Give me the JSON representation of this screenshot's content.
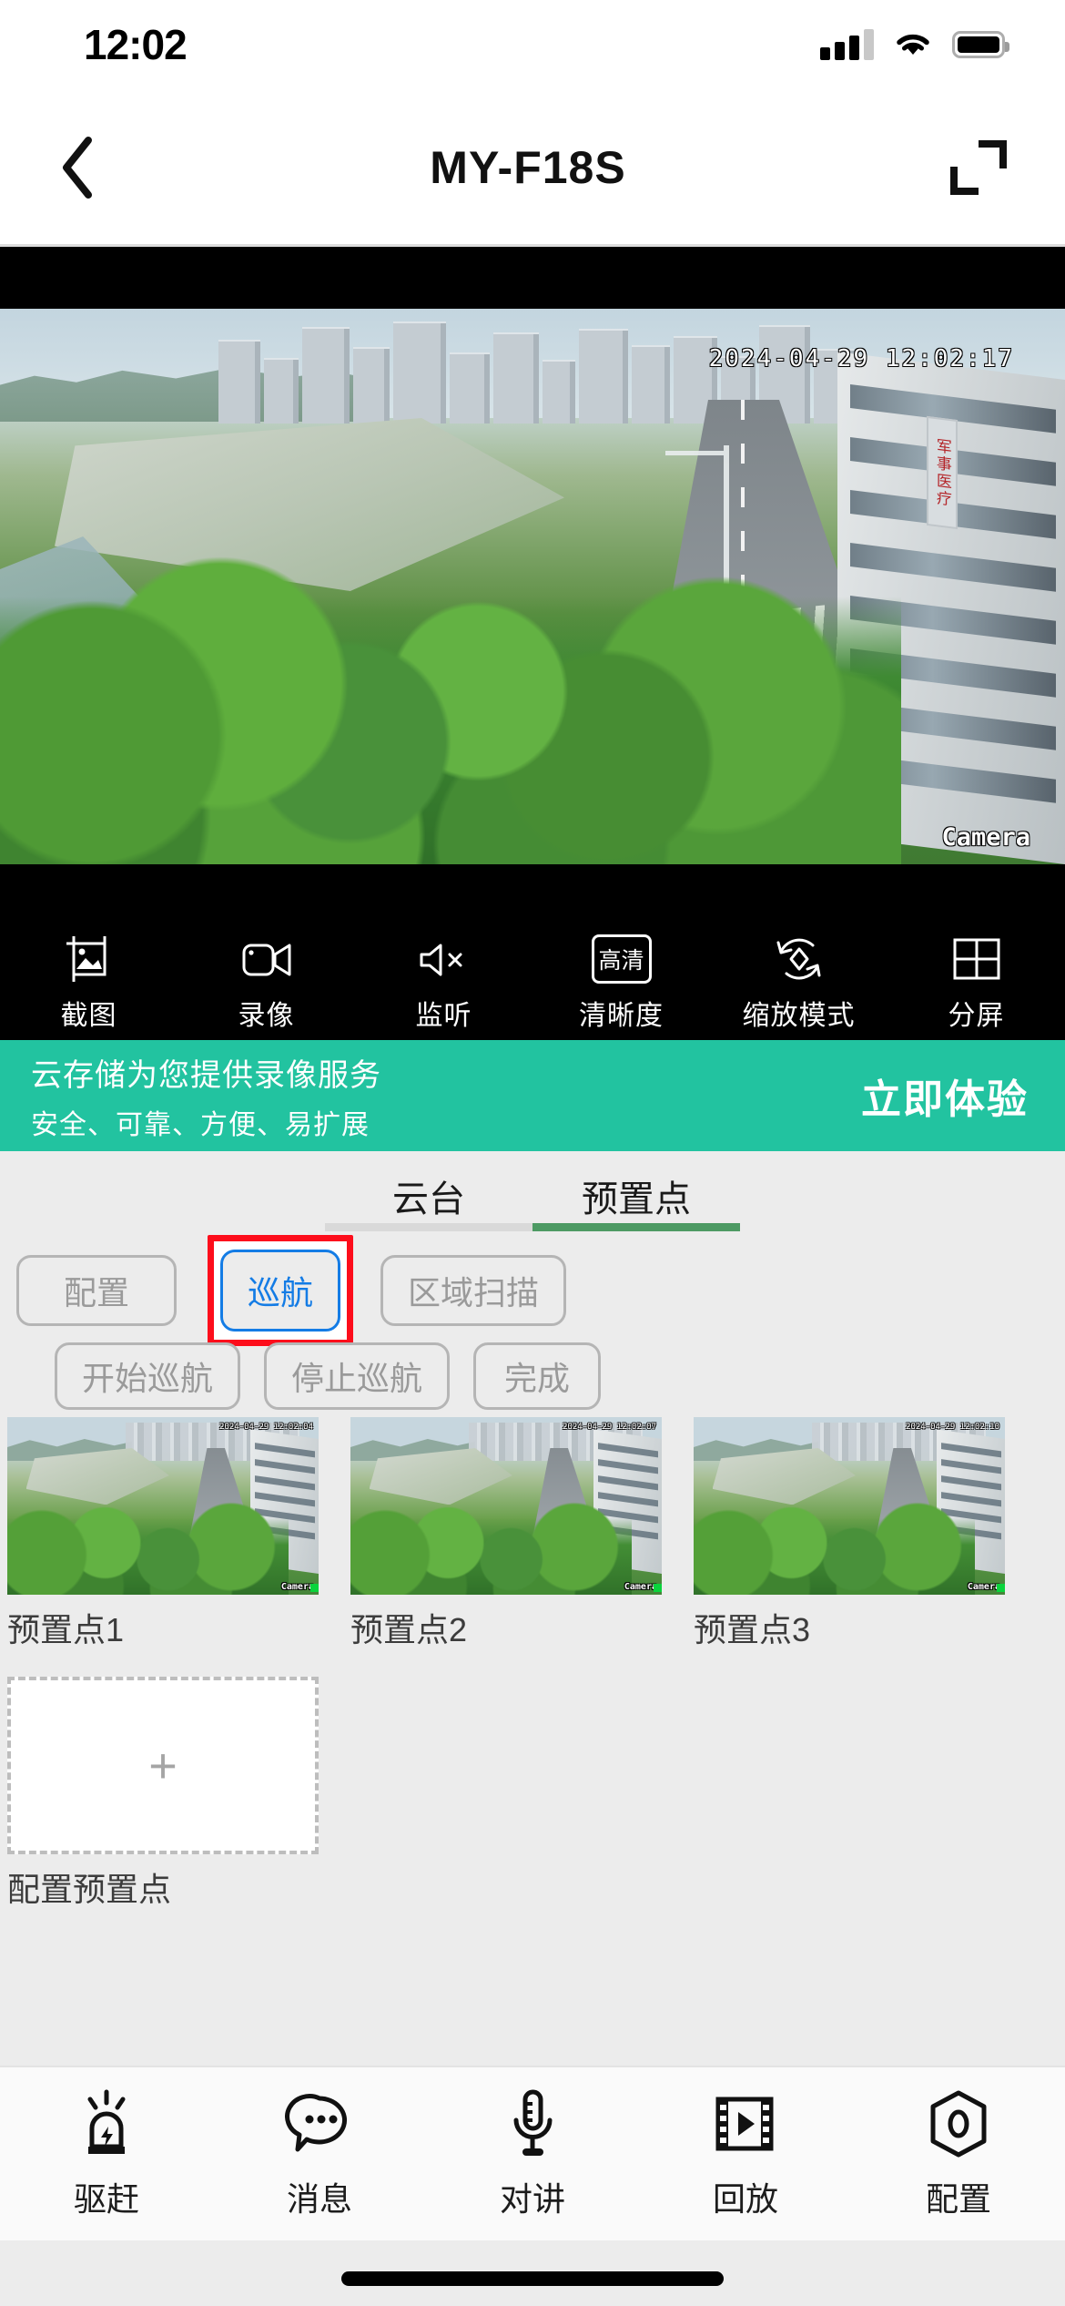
{
  "status_bar": {
    "time": "12:02",
    "signal_icon": "cellular-signal-icon",
    "wifi_icon": "wifi-icon",
    "battery_icon": "battery-full-icon"
  },
  "nav_bar": {
    "back_icon": "chevron-left-icon",
    "title": "MY-F18S",
    "expand_icon": "fullscreen-expand-icon"
  },
  "video": {
    "timestamp_overlay": "2024-04-29  12:02:17",
    "watermark": "Camera",
    "building_sign": "军事医疗"
  },
  "video_toolbar": [
    {
      "label": "截图",
      "icon": "snapshot-icon"
    },
    {
      "label": "录像",
      "icon": "video-record-icon"
    },
    {
      "label": "监听",
      "icon": "speaker-muted-icon"
    },
    {
      "label": "清晰度",
      "icon": "quality-hd-icon",
      "badge": "高清"
    },
    {
      "label": "缩放模式",
      "icon": "zoom-mode-icon"
    },
    {
      "label": "分屏",
      "icon": "split-screen-icon"
    }
  ],
  "cloud_banner": {
    "line1": "云存储为您提供录像服务",
    "line2": "安全、可靠、方便、易扩展",
    "cta": "立即体验",
    "background_color": "#22c3a0"
  },
  "tabs": [
    {
      "label": "云台",
      "active": false
    },
    {
      "label": "预置点",
      "active": true
    }
  ],
  "tab_active_color": "#4d9a63",
  "control_buttons": {
    "row1": [
      {
        "label": "配置",
        "state": "disabled"
      },
      {
        "label": "巡航",
        "state": "selected",
        "highlight_color": "#fd0d1b",
        "accent_color": "#147ce5"
      },
      {
        "label": "区域扫描",
        "state": "disabled"
      }
    ],
    "row2": [
      {
        "label": "开始巡航",
        "state": "normal"
      },
      {
        "label": "停止巡航",
        "state": "normal"
      },
      {
        "label": "完成",
        "state": "normal"
      }
    ]
  },
  "presets": {
    "items": [
      {
        "label": "预置点1",
        "timestamp": "2024-04-29 12:02:04"
      },
      {
        "label": "预置点2",
        "timestamp": "2024-04-29 12:02:07"
      },
      {
        "label": "预置点3",
        "timestamp": "2024-04-29 12:02:10"
      }
    ],
    "add_card": {
      "label": "配置预置点",
      "icon": "plus-icon",
      "symbol": "+"
    }
  },
  "bottom_nav": [
    {
      "label": "驱赶",
      "icon": "siren-alarm-icon"
    },
    {
      "label": "消息",
      "icon": "message-bubble-icon"
    },
    {
      "label": "对讲",
      "icon": "microphone-icon"
    },
    {
      "label": "回放",
      "icon": "film-playback-icon"
    },
    {
      "label": "配置",
      "icon": "settings-hex-icon"
    }
  ]
}
